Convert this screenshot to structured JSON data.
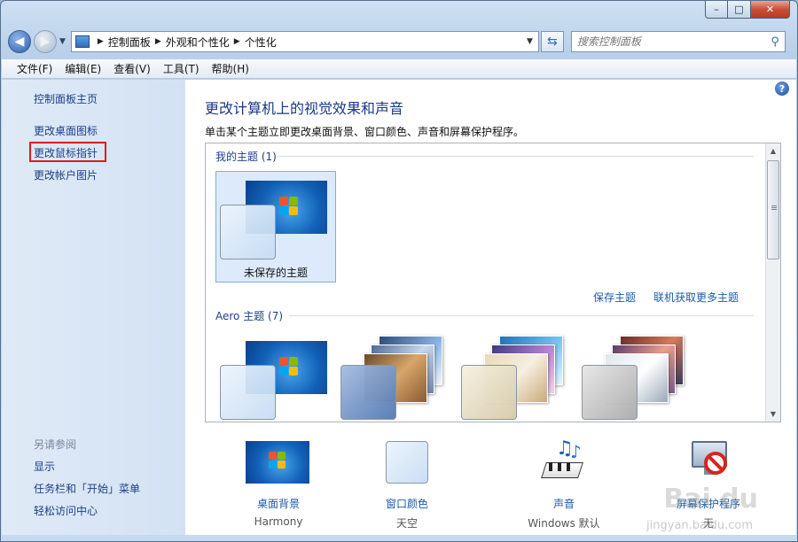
{
  "window": {
    "caption_min": "–",
    "caption_max": "□",
    "caption_close": "✕"
  },
  "navbar": {
    "address_crumbs": [
      "控制面板",
      "外观和个性化",
      "个性化"
    ],
    "search_placeholder": "搜索控制面板"
  },
  "menubar": {
    "items": [
      "文件(F)",
      "编辑(E)",
      "查看(V)",
      "工具(T)",
      "帮助(H)"
    ]
  },
  "sidebar": {
    "home": "控制面板主页",
    "links": [
      "更改桌面图标",
      "更改鼠标指针",
      "更改帐户图片"
    ],
    "see_also_heading": "另请参阅",
    "see_also": [
      "显示",
      "任务栏和「开始」菜单",
      "轻松访问中心"
    ]
  },
  "main": {
    "title": "更改计算机上的视觉效果和声音",
    "description": "单击某个主题立即更改桌面背景、窗口颜色、声音和屏幕保护程序。",
    "my_themes_heading": "我的主题 (1)",
    "unsaved_theme": "未保存的主题",
    "save_theme": "保存主题",
    "get_more_themes": "联机获取更多主题",
    "aero_heading": "Aero 主题 (7)"
  },
  "bottom": [
    {
      "label": "桌面背景",
      "value": "Harmony",
      "icon": "desktop-background-icon"
    },
    {
      "label": "窗口颜色",
      "value": "天空",
      "icon": "window-color-icon"
    },
    {
      "label": "声音",
      "value": "Windows 默认",
      "icon": "sound-icon"
    },
    {
      "label": "屏幕保护程序",
      "value": "无",
      "icon": "screensaver-icon"
    }
  ],
  "watermark": {
    "text": "Bai du",
    "sub": "jingyan.baidu.com"
  }
}
